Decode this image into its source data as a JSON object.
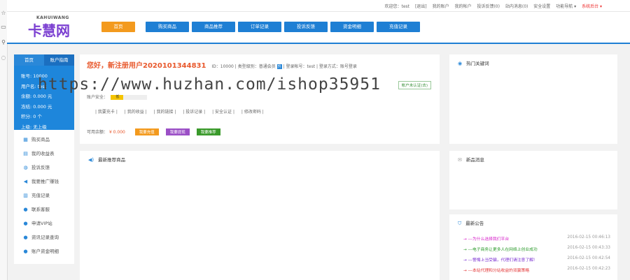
{
  "strip_icons": [
    {
      "name": "star-icon",
      "glyph": "☆"
    },
    {
      "name": "book-icon",
      "glyph": "▭"
    },
    {
      "name": "magnifier-icon",
      "glyph": "⚲"
    },
    {
      "name": "chat-icon",
      "glyph": "◌"
    }
  ],
  "topbar": {
    "items": [
      "欢迎您：test",
      "[退出]",
      "我的账户",
      "我的帐户",
      "投诉反馈(0)",
      "站内消息(0)",
      "安全设置",
      "功能导航 ▾",
      "系统后台 ▾"
    ]
  },
  "header": {
    "logo_small": "KAHUIWANG",
    "logo_big": "卡慧网",
    "nav": [
      {
        "label": "首页",
        "active": true
      },
      {
        "label": "购买商品",
        "active": false
      },
      {
        "label": "商品推荐",
        "active": false
      },
      {
        "label": "订单记录",
        "active": false
      },
      {
        "label": "投诉反馈",
        "active": false
      },
      {
        "label": "资金明细",
        "active": false
      },
      {
        "label": "充值记录",
        "active": false
      }
    ]
  },
  "sidebar": {
    "tabs": [
      {
        "label": "首页",
        "selected": false
      },
      {
        "label": "账户指南",
        "selected": true
      }
    ],
    "info": [
      "账号: 10000",
      "用户名: test",
      "余额: 0.000 元",
      "冻结: 0.000 元",
      "积分: 0 个",
      "上级: 无上级"
    ],
    "menu": [
      {
        "icon": "grid-icon",
        "glyph": "▦",
        "label": "购买商品"
      },
      {
        "icon": "doc-icon",
        "glyph": "▤",
        "label": "我的收益表"
      },
      {
        "icon": "comment-icon",
        "glyph": "◍",
        "label": "投诉反馈"
      },
      {
        "icon": "megaphone-icon",
        "glyph": "◀",
        "label": "我要推广赚钱"
      },
      {
        "icon": "building-icon",
        "glyph": "▥",
        "label": "充值记录"
      },
      {
        "icon": "user-icon",
        "glyph": "●",
        "label": "联系客服"
      },
      {
        "icon": "user-icon",
        "glyph": "●",
        "label": "申请VIP站"
      },
      {
        "icon": "user-icon",
        "glyph": "●",
        "label": "资讯记录查询"
      },
      {
        "icon": "user-icon",
        "glyph": "●",
        "label": "账户资金明细"
      }
    ]
  },
  "main": {
    "hello": "您好，新注册用户2020101344831",
    "id_label": "ID：10000",
    "type_text": "|  类型级别：普通会员",
    "type_badge": "升",
    "login_text": "|  登录帐号：test  |  登录方式：账号登录",
    "verify": "帐户未认证(去)",
    "security_label": "账户安全：",
    "security_level": "低",
    "security_fraction": 0.35,
    "links": [
      "| 我要充卡 |",
      "| 我的收益 |",
      "| 我的链接 |",
      "| 投诉记录 |",
      "| 安全认证 |",
      "| 修改密码 |"
    ],
    "balance_label": "可用余额：",
    "balance_value": "¥ 0.000",
    "buttons": [
      {
        "label": "我要充值",
        "color": "#f39a1e"
      },
      {
        "label": "我要提现",
        "color": "#9b4fc6"
      },
      {
        "label": "我要推荐",
        "color": "#3a9a2b"
      }
    ]
  },
  "watermark": "https://www.huzhan.com/ishop35951",
  "panels": {
    "hot": "热门关键词",
    "products": "最新推荐商品",
    "news": "新品消息",
    "notice": "最新公告"
  },
  "notices": [
    {
      "title": "→  ---为什么选择我们平台",
      "date": "2016-02-15 00:46:13",
      "color": "#d61ec9"
    },
    {
      "title": "→  ---电子商务让更多人在网络上创业成功",
      "date": "2016-02-15 00:43:33",
      "color": "#2a9a2a"
    },
    {
      "title": "→  ---警惕上当受骗，代理们请注意了解!",
      "date": "2016-02-15 00:42:54",
      "color": "#7a2fd1"
    },
    {
      "title": "→  ---本站代理和分站收益的双赢策略",
      "date": "2016-02-15 00:42:23",
      "color": "#e33333"
    }
  ]
}
